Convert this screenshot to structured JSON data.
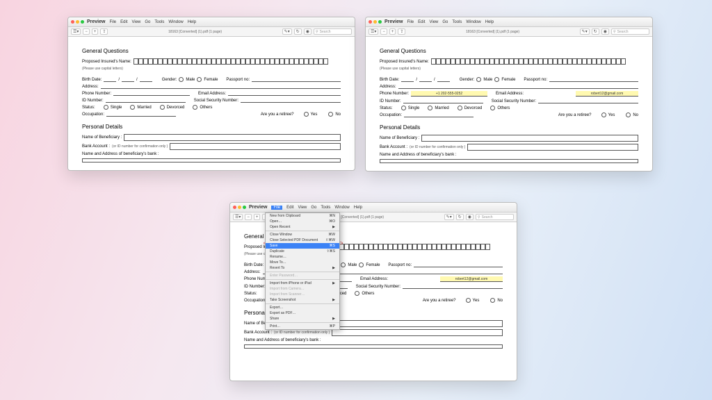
{
  "app": "Preview",
  "menus": [
    "File",
    "Edit",
    "View",
    "Go",
    "Tools",
    "Window",
    "Help"
  ],
  "doctitle": "18163 [Converted] (1).pdf (1 page)",
  "search_ph": "Search",
  "form": {
    "s1": "General Questions",
    "name": "Proposed Insured's Name:",
    "caps": "(Please use capital letters)",
    "bd": "Birth Date:",
    "gender": "Gender:",
    "male": "Male",
    "female": "Female",
    "pass": "Passport no:",
    "addr": "Address:",
    "phone": "Phone Number:",
    "email": "Email Address:",
    "idn": "ID Number:",
    "ssn": "Social Security  Number:",
    "status": "Status:",
    "single": "Single",
    "married": "Married",
    "dev": "Devorced",
    "oth": "Others",
    "occ": "Occupation:",
    "ret": "Are you a retiree?",
    "yes": "Yes",
    "no": "No",
    "s2": "Personal Details",
    "ben": "Name of Beneficiary :",
    "bank": "Bank Account :",
    "bankhint": "(or ID number for confirmation only )",
    "bankaddr": "Name and Address of beneficiary's bank :"
  },
  "vals": {
    "phone": "+1 202-555-0252",
    "email": "robert12@gmail.com"
  },
  "filemenu": {
    "new": "New from Clipboard",
    "open": "Open…",
    "recent": "Open Recent",
    "close": "Close Window",
    "closesel": "Close Selected PDF Document",
    "save": "Save",
    "dup": "Duplicate",
    "ren": "Rename…",
    "mv": "Move To…",
    "rev": "Revert To",
    "pwd": "Enter Password…",
    "imp1": "Import from iPhone or iPad",
    "imp2": "Import from Camera…",
    "imp3": "Import from Scanner…",
    "ts": "Take Screenshot",
    "exp": "Export…",
    "expdf": "Export as PDF…",
    "share": "Share",
    "print": "Print…",
    "kN": "⌘N",
    "kO": "⌘O",
    "kW": "⌘W",
    "kCW": "⇧⌘W",
    "kS": "⌘S",
    "kDS": "⇧⌘S",
    "kP": "⌘P"
  }
}
